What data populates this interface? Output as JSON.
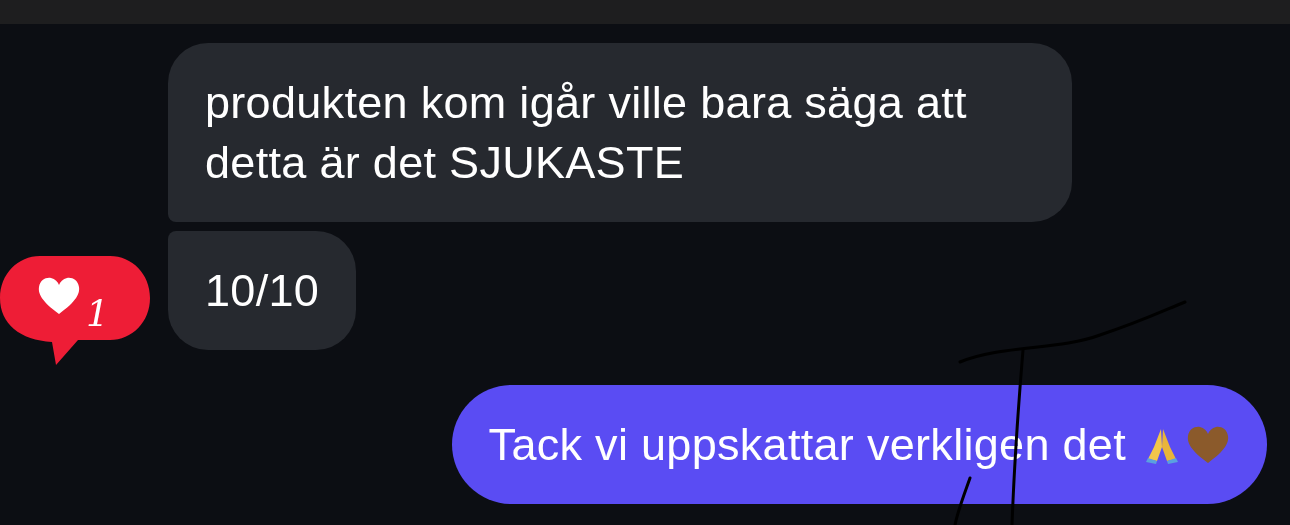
{
  "messages": [
    {
      "kind": "received",
      "text": "produkten kom igår ville bara säga att detta är det SJUKASTE"
    },
    {
      "kind": "received",
      "text": "10/10",
      "reaction": {
        "count": "1"
      }
    },
    {
      "kind": "sent",
      "text": "Tack vi uppskattar verkligen det",
      "emojis": [
        {
          "kind": "pray"
        },
        {
          "kind": "brown-heart"
        }
      ]
    }
  ]
}
